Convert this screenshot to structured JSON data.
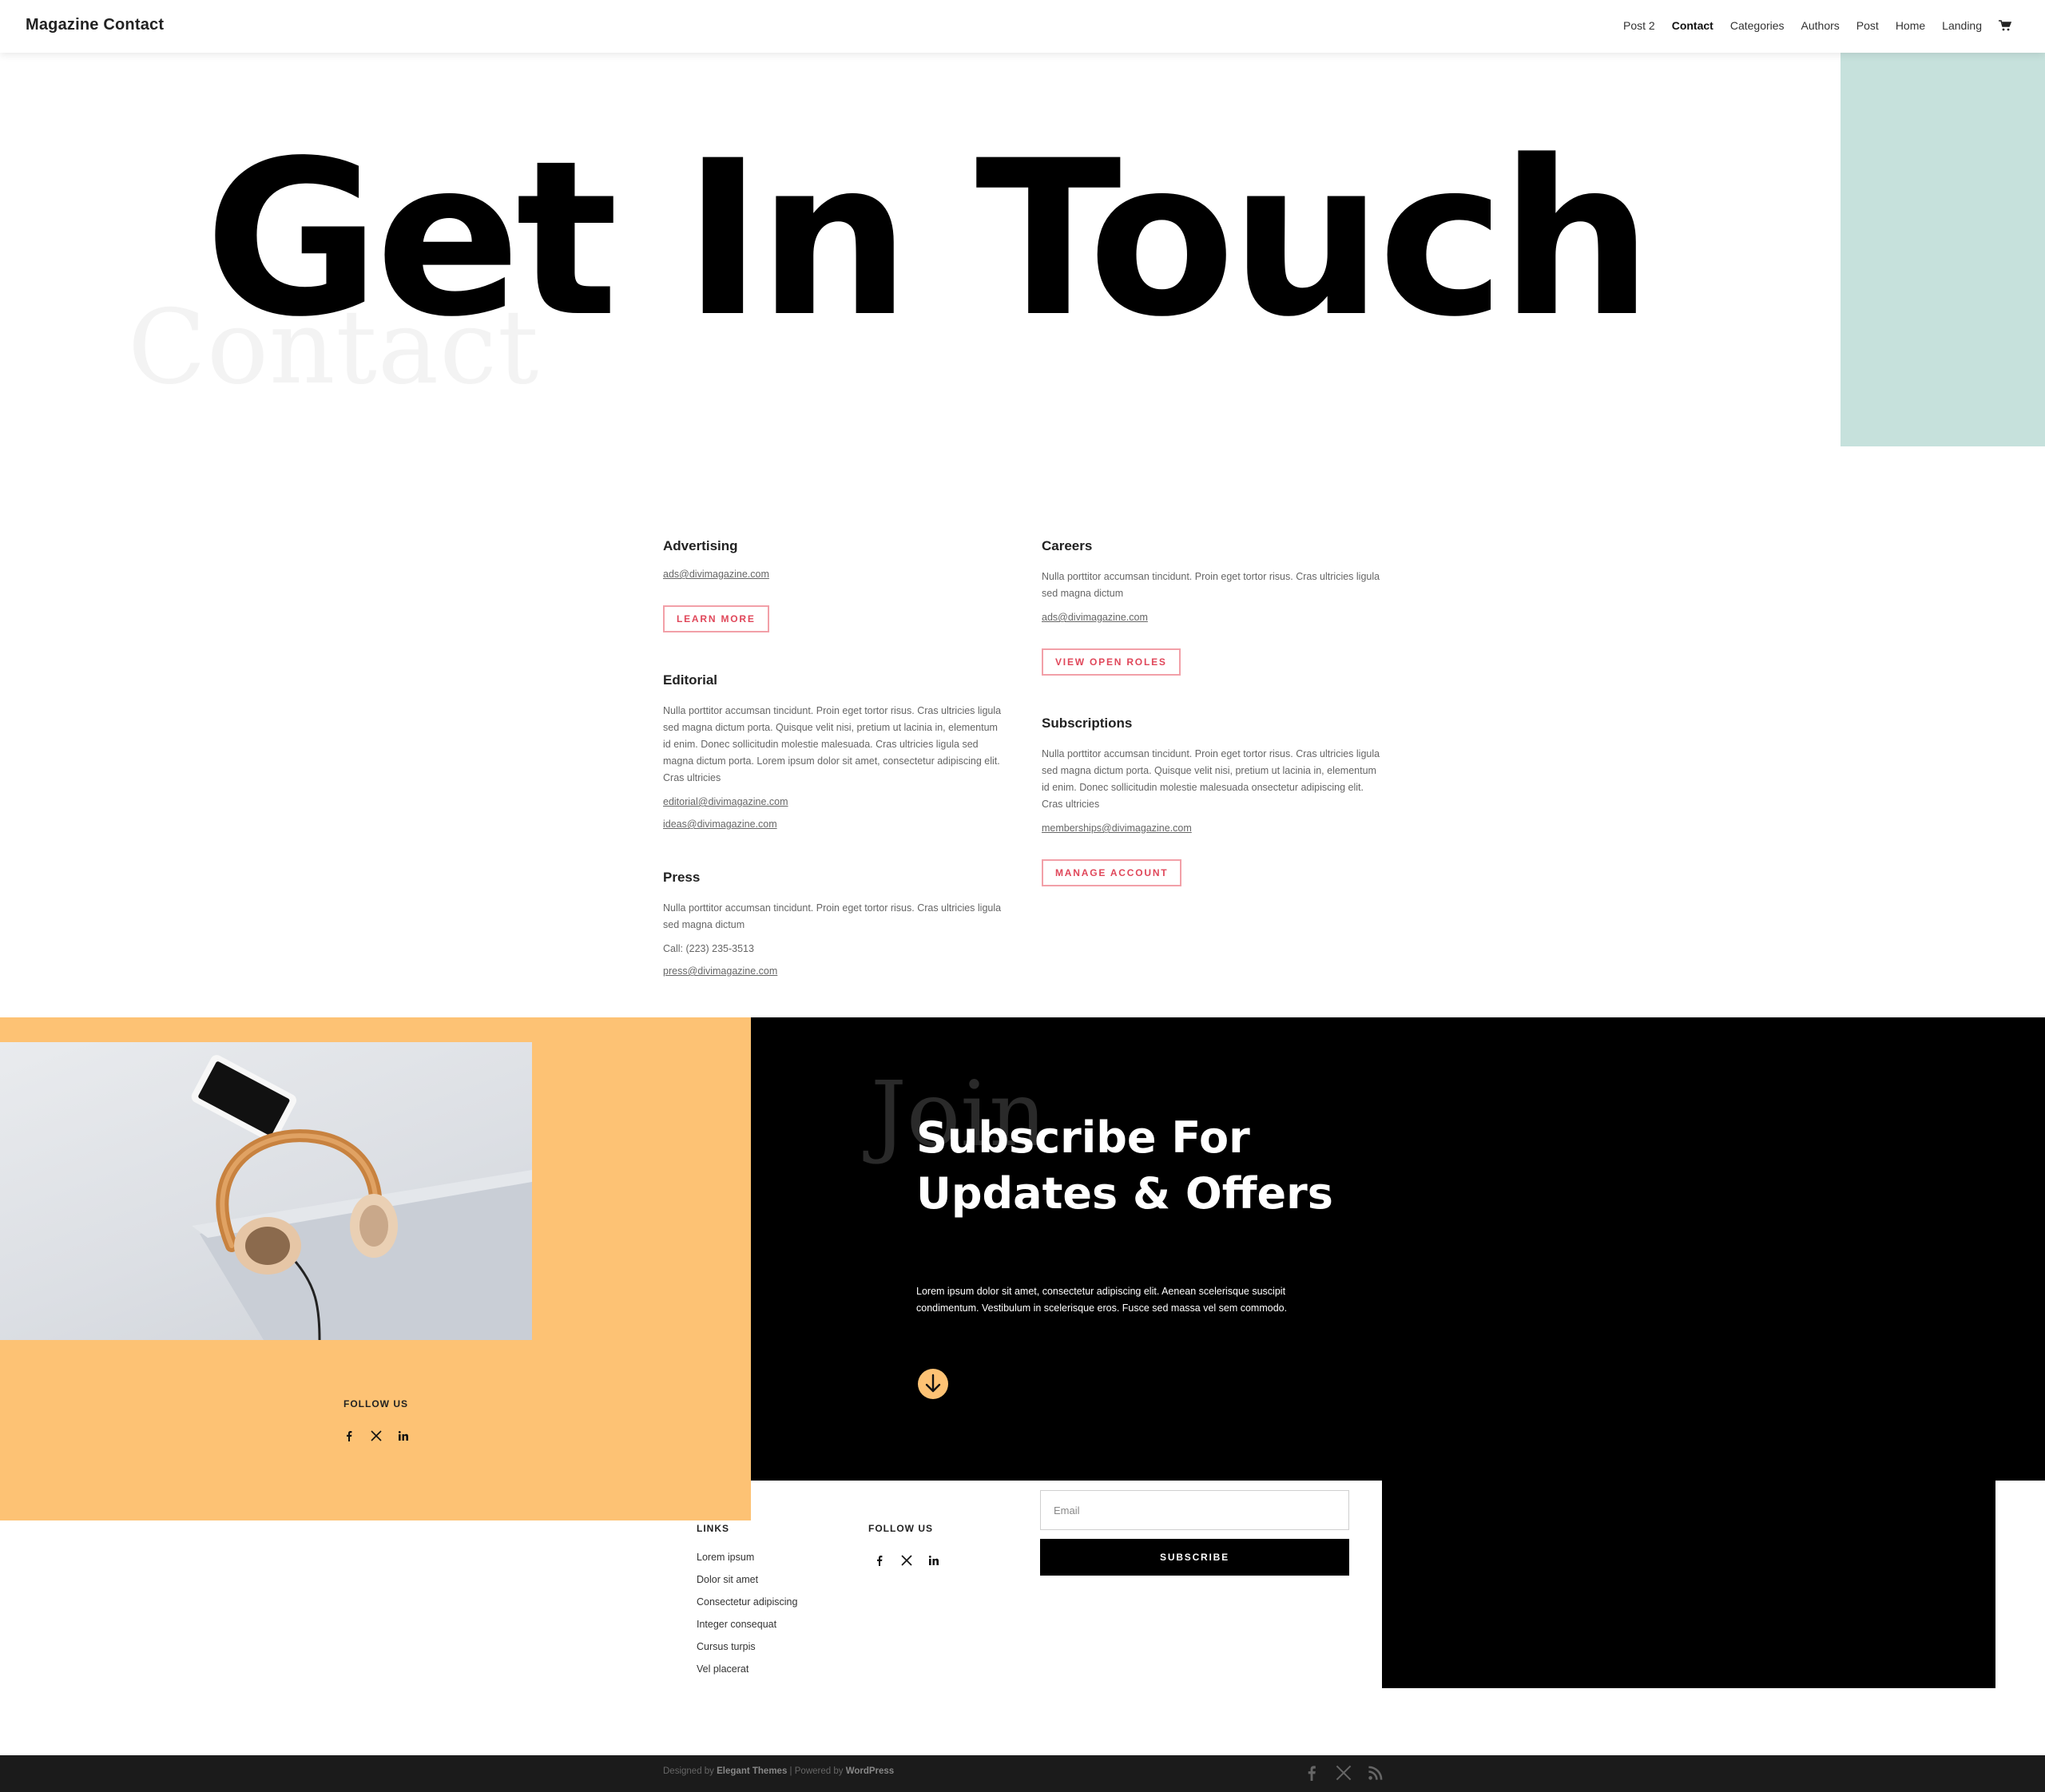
{
  "header": {
    "site_title": "Magazine Contact",
    "nav": [
      "Post 2",
      "Contact",
      "Categories",
      "Authors",
      "Post",
      "Home",
      "Landing"
    ],
    "active_nav": "Contact",
    "cart_icon": "cart-icon"
  },
  "hero": {
    "background_word": "Contact",
    "title": "Get In Touch",
    "accent_color": "#c6e1dc"
  },
  "contact": {
    "advertising": {
      "heading": "Advertising",
      "email": "ads@divimagazine.com",
      "button": "LEARN MORE"
    },
    "editorial": {
      "heading": "Editorial",
      "text": "Nulla porttitor accumsan tincidunt. Proin eget tortor risus. Cras ultricies ligula sed magna dictum porta. Quisque velit nisi, pretium ut lacinia in, elementum id enim. Donec sollicitudin molestie malesuada. Cras ultricies ligula sed magna dictum porta. Lorem ipsum dolor sit amet, consectetur adipiscing elit. Cras ultricies",
      "email_1": "editorial@divimagazine.com",
      "email_2": "ideas@divimagazine.com"
    },
    "press": {
      "heading": "Press",
      "text": "Nulla porttitor accumsan tincidunt. Proin eget tortor risus. Cras ultricies ligula sed magna dictum",
      "phone": "Call: (223) 235-3513",
      "email": "press@divimagazine.com"
    },
    "careers": {
      "heading": "Careers",
      "text": "Nulla porttitor accumsan tincidunt. Proin eget tortor risus. Cras ultricies ligula sed magna dictum",
      "email": "ads@divimagazine.com",
      "button": "VIEW OPEN ROLES"
    },
    "subscriptions": {
      "heading": "Subscriptions",
      "text": "Nulla porttitor accumsan tincidunt. Proin eget tortor risus. Cras ultricies ligula sed magna dictum porta. Quisque velit nisi, pretium ut lacinia in, elementum id enim. Donec sollicitudin molestie malesuada onsectetur adipiscing elit. Cras ultricies",
      "email": "memberships@divimagazine.com",
      "button": "MANAGE ACCOUNT"
    },
    "button_color": "#e0475a"
  },
  "subscribe": {
    "background_word": "Join",
    "title": "Subscribe For Updates & Offers",
    "text": "Lorem ipsum dolor sit amet, consectetur adipiscing elit. Aenean scelerisque suscipit condimentum. Vestibulum in scelerisque eros. Fusce sed massa vel sem commodo.",
    "arrow_icon": "arrow-down-circle-icon",
    "follow_label": "FOLLOW US",
    "orange_color": "#fdc274"
  },
  "footer": {
    "links_label": "LINKS",
    "links": [
      "Lorem ipsum",
      "Dolor sit amet",
      "Consectetur adipiscing",
      "Integer consequat",
      "Cursus turpis",
      "Vel placerat"
    ],
    "follow_label": "FOLLOW US",
    "social_icons": [
      "facebook-icon",
      "x-icon",
      "linkedin-icon"
    ],
    "email_placeholder": "Email",
    "subscribe_button": "SUBSCRIBE"
  },
  "bottom_bar": {
    "designed_by": "Designed by",
    "elegant_themes": "Elegant Themes",
    "separator": "|",
    "powered_by": "Powered by",
    "wordpress": "WordPress",
    "icons": [
      "facebook-icon",
      "x-icon",
      "rss-icon"
    ]
  }
}
